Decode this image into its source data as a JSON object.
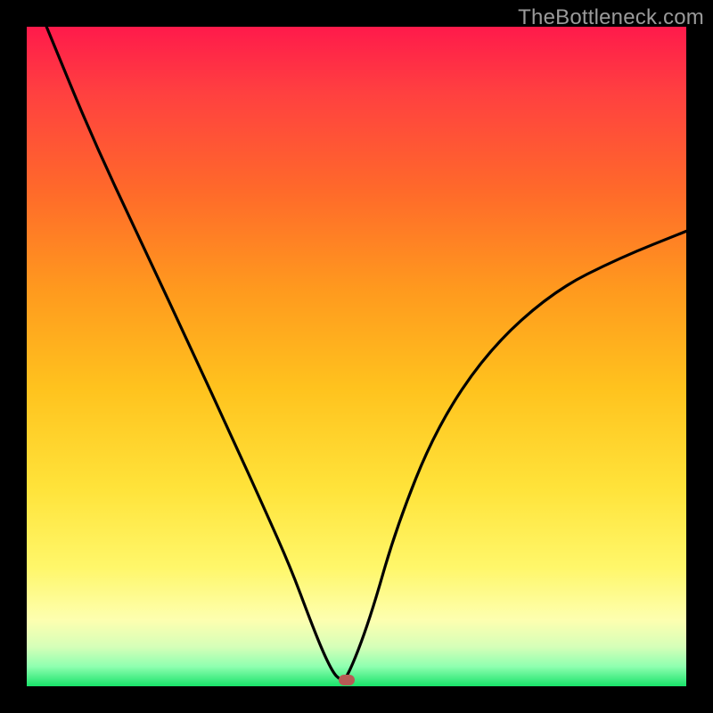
{
  "watermark": "TheBottleneck.com",
  "chart_data": {
    "type": "line",
    "title": "",
    "xlabel": "",
    "ylabel": "",
    "xlim": [
      0,
      100
    ],
    "ylim": [
      0,
      100
    ],
    "series": [
      {
        "name": "bottleneck-curve",
        "x": [
          3,
          10,
          18,
          25,
          31,
          36,
          40,
          43,
          45,
          46.5,
          47.5,
          48.5,
          52,
          56,
          62,
          70,
          80,
          90,
          100
        ],
        "values": [
          100,
          83,
          66,
          51,
          38,
          27,
          18,
          10,
          5,
          2,
          1,
          1,
          10,
          24,
          39,
          51,
          60,
          65,
          69
        ]
      }
    ],
    "marker": {
      "x": 48.5,
      "y": 1,
      "color": "#b75a55"
    },
    "gradient_stops": [
      {
        "pct": 0,
        "color": "#ff1a4b"
      },
      {
        "pct": 25,
        "color": "#ff6a2a"
      },
      {
        "pct": 55,
        "color": "#ffc31e"
      },
      {
        "pct": 82,
        "color": "#fff76a"
      },
      {
        "pct": 100,
        "color": "#19e36a"
      }
    ]
  }
}
